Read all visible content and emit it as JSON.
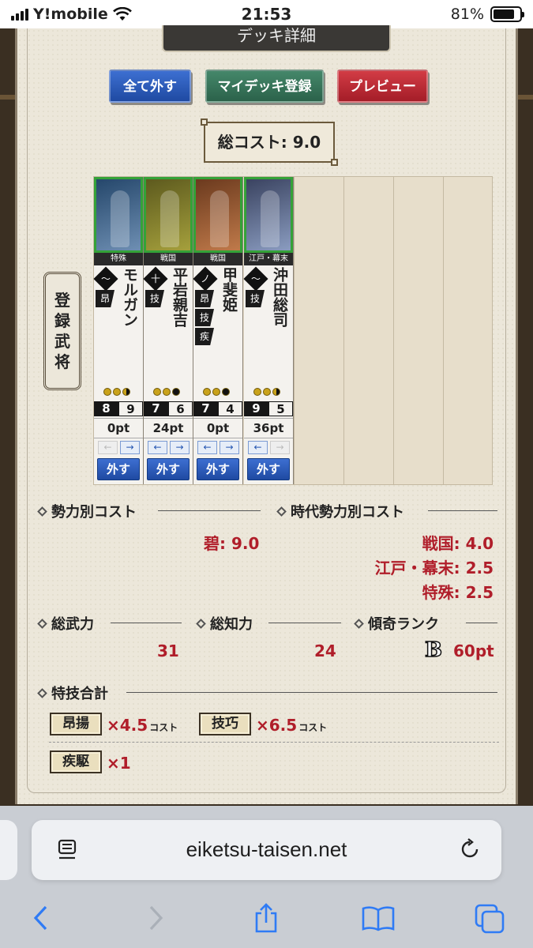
{
  "status_bar": {
    "carrier": "Y!mobile",
    "time": "21:53",
    "battery": "81%"
  },
  "dialog": {
    "title": "デッキ詳細",
    "buttons": {
      "remove_all": "全て外す",
      "register": "マイデッキ登録",
      "preview": "プレビュー"
    },
    "total_cost": "総コスト: 9.0",
    "side_label": [
      "登",
      "録",
      "武",
      "将"
    ],
    "cards": [
      {
        "era": "特殊",
        "crest": "〜",
        "skills": [
          "昂"
        ],
        "name": "モルガン",
        "dots": [
          "full",
          "full",
          "half"
        ],
        "atk": "8",
        "int": "9",
        "pt": "0pt",
        "remove": "外す",
        "left_enabled": false,
        "right_enabled": true
      },
      {
        "era": "戦国",
        "crest": "十",
        "skills": [
          "技"
        ],
        "name": "平岩親吉",
        "dots": [
          "full",
          "full",
          "black"
        ],
        "atk": "7",
        "int": "6",
        "pt": "24pt",
        "remove": "外す",
        "left_enabled": true,
        "right_enabled": true
      },
      {
        "era": "戦国",
        "crest": "ノ",
        "skills": [
          "昂",
          "技",
          "疾"
        ],
        "name": "甲斐姫",
        "dots": [
          "full",
          "full",
          "black"
        ],
        "atk": "7",
        "int": "4",
        "pt": "0pt",
        "remove": "外す",
        "left_enabled": true,
        "right_enabled": true
      },
      {
        "era": "江戸・幕末",
        "crest": "〜",
        "skills": [
          "技"
        ],
        "name": "沖田総司",
        "dots": [
          "full",
          "full",
          "half"
        ],
        "atk": "9",
        "int": "5",
        "pt": "36pt",
        "remove": "外す",
        "left_enabled": true,
        "right_enabled": false
      }
    ],
    "arrow_left": "←",
    "arrow_right": "→",
    "faction_cost": {
      "label": "勢力別コスト",
      "value": "碧: 9.0"
    },
    "era_cost": {
      "label": "時代勢力別コスト",
      "values": [
        "戦国: 4.0",
        "江戸・幕末: 2.5",
        "特殊: 2.5"
      ]
    },
    "total_atk": {
      "label": "総武力",
      "value": "31"
    },
    "total_int": {
      "label": "総知力",
      "value": "24"
    },
    "rank": {
      "label": "傾奇ランク",
      "grade": "B",
      "value": "60pt"
    },
    "skills_total": {
      "label": "特技合計",
      "items": [
        {
          "name": "昂揚",
          "value": "×4.5",
          "unit": "コスト"
        },
        {
          "name": "技巧",
          "value": "×6.5",
          "unit": "コスト"
        },
        {
          "name": "疾駆",
          "value": "×1",
          "unit": ""
        }
      ]
    }
  },
  "browser": {
    "url": "eiketsu-taisen.net"
  },
  "colors": {
    "accent_red": "#b01e2a",
    "button_blue": "#1f4aa2",
    "button_green": "#2b624a",
    "button_red": "#a41d28"
  }
}
